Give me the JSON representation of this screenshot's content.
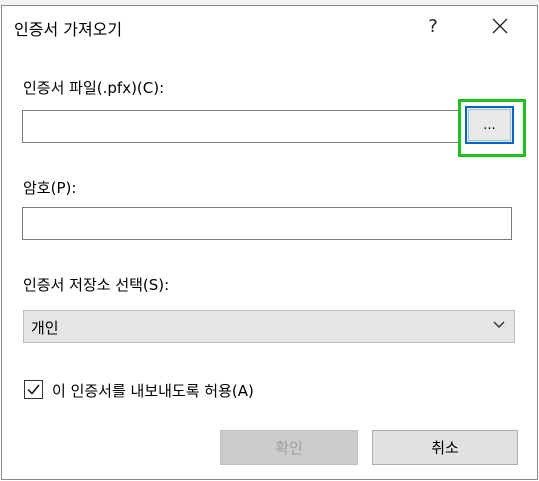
{
  "dialog": {
    "title": "인증서 가져오기",
    "help_label": "?",
    "close_icon": "close-icon"
  },
  "cert_file": {
    "label": "인증서 파일(.pfx)(C):",
    "value": "",
    "browse_label": "..."
  },
  "password": {
    "label": "암호(P):",
    "value": ""
  },
  "store": {
    "label": "인증서 저장소 선택(S):",
    "selected": "개인"
  },
  "export": {
    "label": "이 인증서를 내보내도록 허용(A)",
    "checked": true
  },
  "buttons": {
    "ok": "확인",
    "cancel": "취소"
  },
  "colors": {
    "highlight": "#22c11f",
    "focus": "#0067c0"
  }
}
